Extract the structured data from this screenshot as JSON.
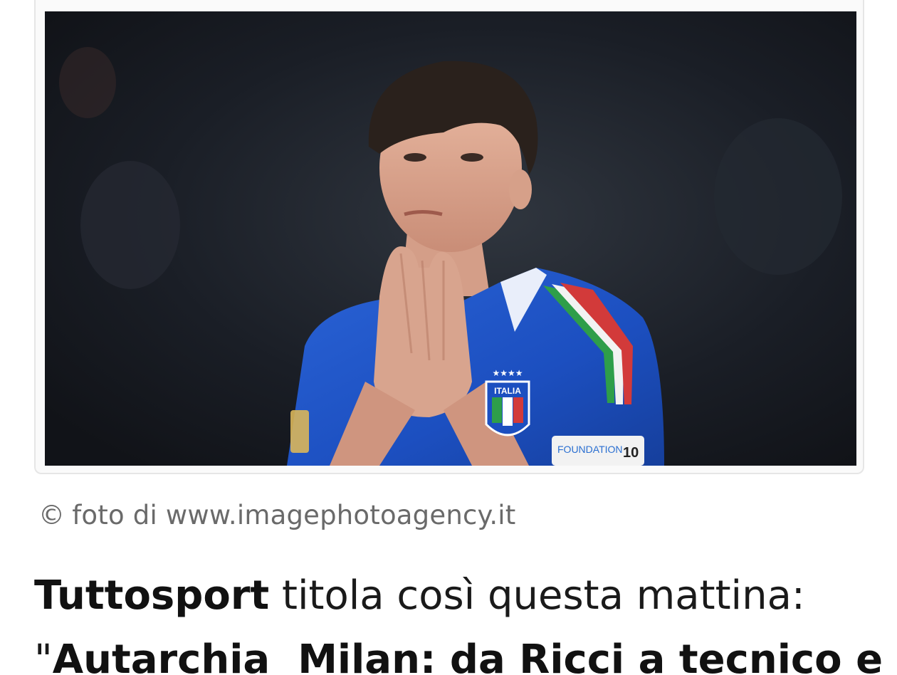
{
  "photo": {
    "description_icon": "football-player-photo-icon",
    "crest_text": "ITALIA",
    "sleeve_badge_text": "FOUNDATION",
    "sleeve_badge_number": "10"
  },
  "caption": {
    "copyright_symbol": "©",
    "text": "foto di www.imagephotoagency.it"
  },
  "article": {
    "line1_bold": "Tuttosport",
    "line1_rest": " titola così questa mattina:",
    "line2_quote": "\"",
    "line2_bold": "Autarchia  Milan: da Ricci a tecnico e"
  },
  "colors": {
    "jersey_blue": "#1f55c8",
    "text_primary": "#1a1a1a",
    "caption_gray": "#6a6a6a"
  }
}
